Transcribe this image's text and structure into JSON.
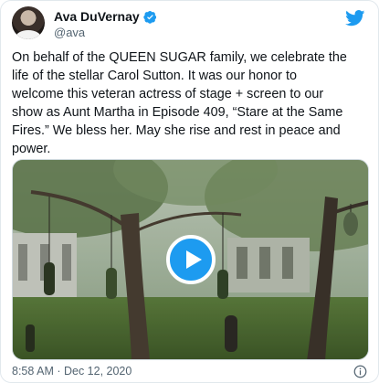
{
  "author": {
    "name": "Ava DuVernay",
    "handle": "@ava"
  },
  "icons": {
    "verified": "verified-badge-icon",
    "brand": "twitter-bird-icon",
    "play": "play-icon",
    "info": "info-icon"
  },
  "colors": {
    "accent": "#1d9bf0",
    "text": "#0f1419",
    "muted": "#536471"
  },
  "tweet": {
    "text": "On behalf of the QUEEN SUGAR family, we celebrate the\nlife of the stellar Carol Sutton. It was our honor to\nwelcome this veteran actress of stage + screen to our\nshow as Aunt Martha in Episode 409, “Stare at the Same\nFires.” We bless her. May she rise and rest in peace and\npower.",
    "timestamp": "8:58 AM · Dec 12, 2020"
  }
}
